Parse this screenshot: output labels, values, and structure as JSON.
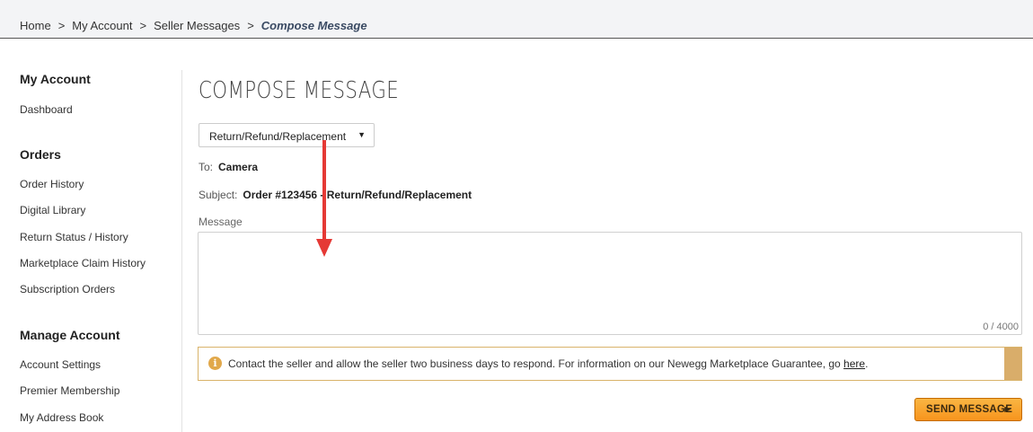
{
  "breadcrumb": {
    "items": [
      "Home",
      "My Account",
      "Seller Messages"
    ],
    "current": "Compose Message",
    "separator": ">"
  },
  "sidebar": {
    "sections": [
      {
        "title": "My Account",
        "links": [
          "Dashboard"
        ]
      },
      {
        "title": "Orders",
        "links": [
          "Order History",
          "Digital Library",
          "Return Status / History",
          "Marketplace Claim History",
          "Subscription Orders"
        ]
      },
      {
        "title": "Manage Account",
        "links": [
          "Account Settings",
          "Premier Membership",
          "My Address Book"
        ]
      }
    ]
  },
  "main": {
    "title": "COMPOSE MESSAGE",
    "topic_select": {
      "value": "Return/Refund/Replacement"
    },
    "to": {
      "label": "To:",
      "value": "Camera"
    },
    "subject": {
      "label": "Subject:",
      "value": "Order #123456 - Return/Refund/Replacement"
    },
    "message": {
      "label": "Message",
      "value": "",
      "counter": "0 / 4000"
    },
    "notice": {
      "icon": "info-icon",
      "text": "Contact the seller and allow the seller two business days to respond. For information on our Newegg Marketplace Guarantee, go ",
      "link": "here",
      "suffix": "."
    },
    "send_button": "SEND MESSAGE"
  },
  "colors": {
    "accent_button": "#f7941d",
    "notice_border": "#d9b36a",
    "annotation_arrow": "#e53935"
  }
}
